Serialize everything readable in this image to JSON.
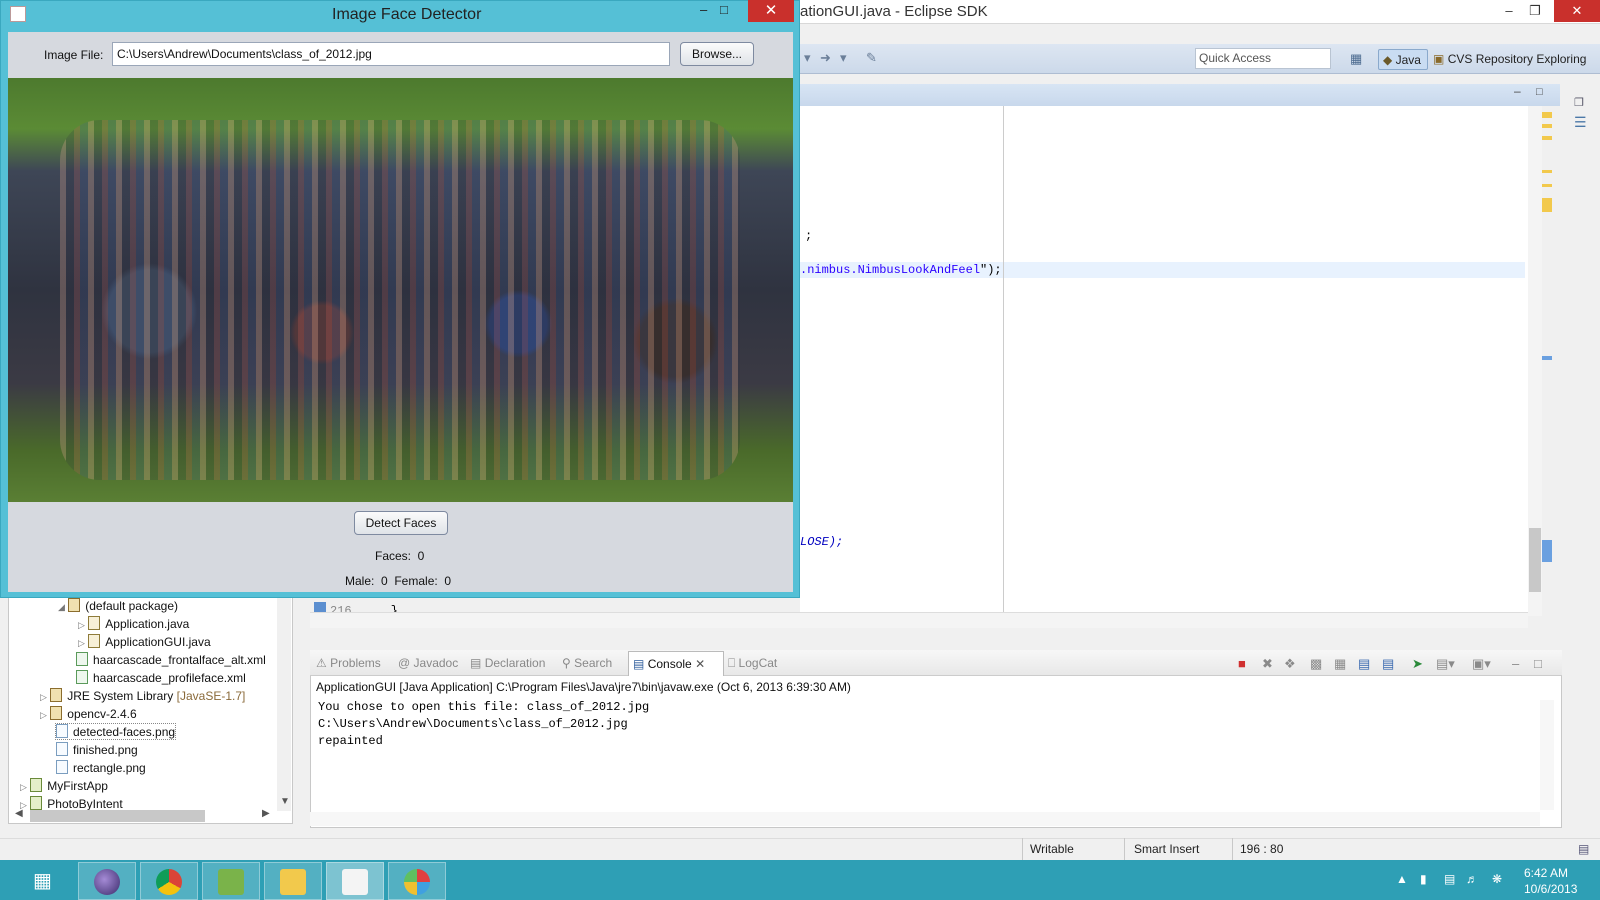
{
  "eclipse": {
    "title": "ationGUI.java - Eclipse SDK",
    "quick_access": "Quick Access",
    "perspective_java": "Java",
    "perspective_cvs": "CVS Repository Exploring",
    "code_lines": [
      {
        "text": ";"
      },
      {
        "pre": ".nimbus.NimbusLookAndFeel",
        "post": "\");"
      },
      {
        "text": "LOSE);"
      },
      {
        "line_no": "216",
        "text": "    }"
      }
    ]
  },
  "package_explorer": {
    "items": [
      {
        "label": "(default package)",
        "icon": "package-icon"
      },
      {
        "label": "Application.java",
        "icon": "java-file-icon"
      },
      {
        "label": "ApplicationGUI.java",
        "icon": "java-file-icon"
      },
      {
        "label": "haarcascade_frontalface_alt.xml",
        "icon": "xml-file-icon"
      },
      {
        "label": "haarcascade_profileface.xml",
        "icon": "xml-file-icon"
      },
      {
        "label": "JRE System Library",
        "suffix": "[JavaSE-1.7]",
        "icon": "library-icon"
      },
      {
        "label": "opencv-2.4.6",
        "icon": "library-icon"
      },
      {
        "label": "detected-faces.png",
        "icon": "image-file-icon"
      },
      {
        "label": "finished.png",
        "icon": "image-file-icon"
      },
      {
        "label": "rectangle.png",
        "icon": "image-file-icon"
      },
      {
        "label": "MyFirstApp",
        "icon": "project-icon"
      },
      {
        "label": "PhotoByIntent",
        "icon": "project-icon"
      }
    ]
  },
  "console": {
    "tabs": [
      "Problems",
      "Javadoc",
      "Declaration",
      "Search",
      "Console",
      "LogCat"
    ],
    "active_tab": "Console",
    "launch": "ApplicationGUI [Java Application] C:\\Program Files\\Java\\jre7\\bin\\javaw.exe (Oct 6, 2013 6:39:30 AM)",
    "output": [
      "You chose to open this file: class_of_2012.jpg",
      "C:\\Users\\Andrew\\Documents\\class_of_2012.jpg",
      "repainted"
    ]
  },
  "statusbar": {
    "writable": "Writable",
    "insert_mode": "Smart Insert",
    "position": "196 : 80"
  },
  "taskbar": {
    "time": "6:42 AM",
    "date": "10/6/2013"
  },
  "face_detector": {
    "title": "Image Face Detector",
    "image_file_label": "Image File:",
    "image_path": "C:\\Users\\Andrew\\Documents\\class_of_2012.jpg",
    "browse_label": "Browse...",
    "detect_label": "Detect Faces",
    "faces_text": "Faces:  0",
    "gender_text": "Male:  0  Female:  0"
  }
}
